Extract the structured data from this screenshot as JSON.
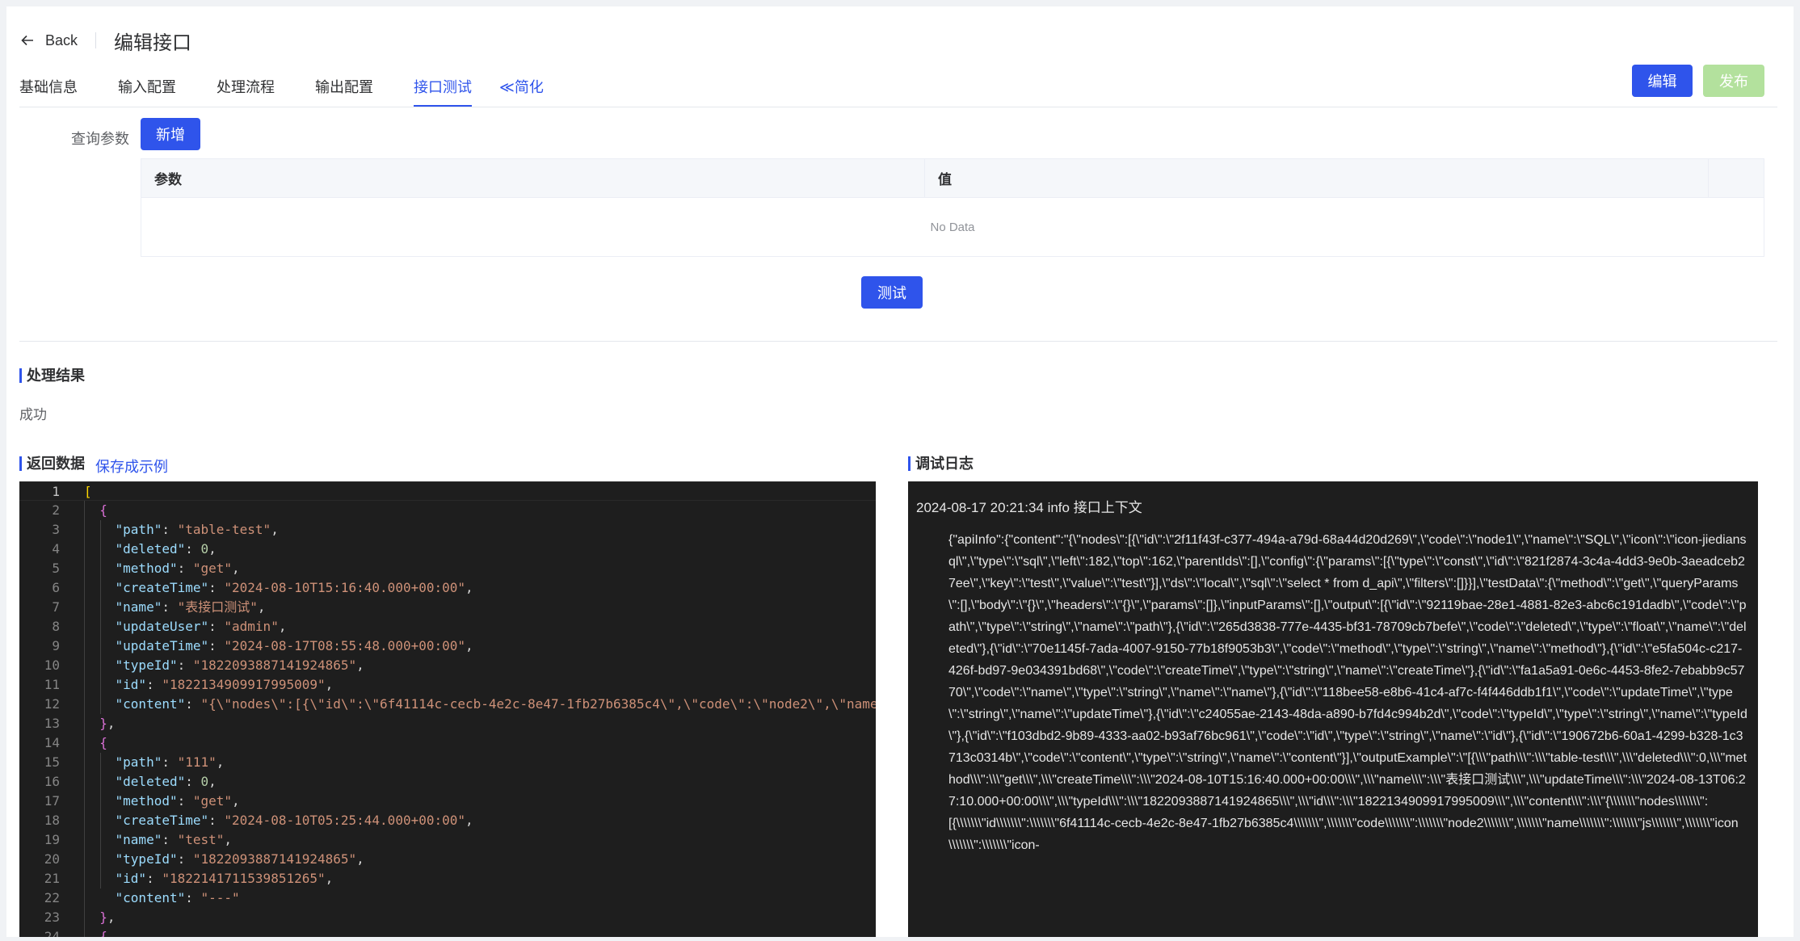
{
  "header": {
    "back_label": "Back",
    "title": "编辑接口"
  },
  "tabs": [
    {
      "label": "基础信息",
      "active": false
    },
    {
      "label": "输入配置",
      "active": false
    },
    {
      "label": "处理流程",
      "active": false
    },
    {
      "label": "输出配置",
      "active": false
    },
    {
      "label": "接口测试",
      "active": true
    }
  ],
  "collapse_label": "≪简化",
  "actions": {
    "edit_label": "编辑",
    "publish_label": "发布"
  },
  "query": {
    "label": "查询参数",
    "add_label": "新增",
    "columns": [
      "参数",
      "值"
    ],
    "empty_text": "No Data",
    "test_label": "测试"
  },
  "result": {
    "title": "处理结果",
    "value": "成功"
  },
  "returned": {
    "title": "返回数据",
    "save_label": "保存成示例"
  },
  "log": {
    "title": "调试日志",
    "header": "2024-08-17 20:21:34 info 接口上下文",
    "body": "{\"apiInfo\":{\"content\":\"{\\\"nodes\\\":[{\\\"id\\\":\\\"2f11f43f-c377-494a-a79d-68a44d20d269\\\",\\\"code\\\":\\\"node1\\\",\\\"name\\\":\\\"SQL\\\",\\\"icon\\\":\\\"icon-jiediansql\\\",\\\"type\\\":\\\"sql\\\",\\\"left\\\":182,\\\"top\\\":162,\\\"parentIds\\\":[],\\\"config\\\":{\\\"params\\\":[{\\\"type\\\":\\\"const\\\",\\\"id\\\":\\\"821f2874-3c4a-4dd3-9e0b-3aeadceb27ee\\\",\\\"key\\\":\\\"test\\\",\\\"value\\\":\\\"test\\\"}],\\\"ds\\\":\\\"local\\\",\\\"sql\\\":\\\"select * from d_api\\\",\\\"filters\\\":[]}}],\\\"testData\\\":{\\\"method\\\":\\\"get\\\",\\\"queryParams\\\":[],\\\"body\\\":\\\"{}\\\",\\\"headers\\\":\\\"{}\\\",\\\"params\\\":[]},\\\"inputParams\\\":[],\\\"output\\\":[{\\\"id\\\":\\\"92119bae-28e1-4881-82e3-abc6c191dadb\\\",\\\"code\\\":\\\"path\\\",\\\"type\\\":\\\"string\\\",\\\"name\\\":\\\"path\\\"},{\\\"id\\\":\\\"265d3838-777e-4435-bf31-78709cb7befe\\\",\\\"code\\\":\\\"deleted\\\",\\\"type\\\":\\\"float\\\",\\\"name\\\":\\\"deleted\\\"},{\\\"id\\\":\\\"70e1145f-7ada-4007-9150-77b18f9053b3\\\",\\\"code\\\":\\\"method\\\",\\\"type\\\":\\\"string\\\",\\\"name\\\":\\\"method\\\"},{\\\"id\\\":\\\"e5fa504c-c217-426f-bd97-9e034391bd68\\\",\\\"code\\\":\\\"createTime\\\",\\\"type\\\":\\\"string\\\",\\\"name\\\":\\\"createTime\\\"},{\\\"id\\\":\\\"fa1a5a91-0e6c-4453-8fe2-7ebabb9c5770\\\",\\\"code\\\":\\\"name\\\",\\\"type\\\":\\\"string\\\",\\\"name\\\":\\\"name\\\"},{\\\"id\\\":\\\"118bee58-e8b6-41c4-af7c-f4f446ddb1f1\\\",\\\"code\\\":\\\"updateTime\\\",\\\"type\\\":\\\"string\\\",\\\"name\\\":\\\"updateTime\\\"},{\\\"id\\\":\\\"c24055ae-2143-48da-a890-b7fd4c994b2d\\\",\\\"code\\\":\\\"typeId\\\",\\\"type\\\":\\\"string\\\",\\\"name\\\":\\\"typeId\\\"},{\\\"id\\\":\\\"f103dbd2-9b89-4333-aa02-b93af76bc961\\\",\\\"code\\\":\\\"id\\\",\\\"type\\\":\\\"string\\\",\\\"name\\\":\\\"id\\\"},{\\\"id\\\":\\\"190672b6-60a1-4299-b328-1c3713c0314b\\\",\\\"code\\\":\\\"content\\\",\\\"type\\\":\\\"string\\\",\\\"name\\\":\\\"content\\\"}],\\\"outputExample\\\":\\\"[{\\\\\\\"path\\\\\\\":\\\\\\\"table-test\\\\\\\",\\\\\\\"deleted\\\\\\\":0,\\\\\\\"method\\\\\\\":\\\\\\\"get\\\\\\\",\\\\\\\"createTime\\\\\\\":\\\\\\\"2024-08-10T15:16:40.000+00:00\\\\\\\",\\\\\\\"name\\\\\\\":\\\\\\\"表接口测试\\\\\\\",\\\\\\\"updateTime\\\\\\\":\\\\\\\"2024-08-13T06:27:10.000+00:00\\\\\\\",\\\\\\\"typeId\\\\\\\":\\\\\\\"1822093887141924865\\\\\\\",\\\\\\\"id\\\\\\\":\\\\\\\"1822134909917995009\\\\\\\",\\\\\\\"content\\\\\\\":\\\\\\\"{\\\\\\\\\\\\\\\"nodes\\\\\\\\\\\\\\\":[{\\\\\\\\\\\\\\\"id\\\\\\\\\\\\\\\":\\\\\\\\\\\\\\\"6f41114c-cecb-4e2c-8e47-1fb27b6385c4\\\\\\\\\\\\\\\",\\\\\\\\\\\\\\\"code\\\\\\\\\\\\\\\":\\\\\\\\\\\\\\\"node2\\\\\\\\\\\\\\\",\\\\\\\\\\\\\\\"name\\\\\\\\\\\\\\\":\\\\\\\\\\\\\\\"js\\\\\\\\\\\\\\\",\\\\\\\\\\\\\\\"icon\\\\\\\\\\\\\\\":\\\\\\\\\\\\\\\"icon-"
  },
  "editor": {
    "lines": [
      [
        [
          "b1",
          "["
        ]
      ],
      [
        [
          "p",
          "  "
        ],
        [
          "b2",
          "{"
        ]
      ],
      [
        [
          "p",
          "    "
        ],
        [
          "k",
          "\"path\""
        ],
        [
          "p",
          ": "
        ],
        [
          "s",
          "\"table-test\""
        ],
        [
          "p",
          ","
        ]
      ],
      [
        [
          "p",
          "    "
        ],
        [
          "k",
          "\"deleted\""
        ],
        [
          "p",
          ": "
        ],
        [
          "n",
          "0"
        ],
        [
          "p",
          ","
        ]
      ],
      [
        [
          "p",
          "    "
        ],
        [
          "k",
          "\"method\""
        ],
        [
          "p",
          ": "
        ],
        [
          "s",
          "\"get\""
        ],
        [
          "p",
          ","
        ]
      ],
      [
        [
          "p",
          "    "
        ],
        [
          "k",
          "\"createTime\""
        ],
        [
          "p",
          ": "
        ],
        [
          "s",
          "\"2024-08-10T15:16:40.000+00:00\""
        ],
        [
          "p",
          ","
        ]
      ],
      [
        [
          "p",
          "    "
        ],
        [
          "k",
          "\"name\""
        ],
        [
          "p",
          ": "
        ],
        [
          "s",
          "\"表接口测试\""
        ],
        [
          "p",
          ","
        ]
      ],
      [
        [
          "p",
          "    "
        ],
        [
          "k",
          "\"updateUser\""
        ],
        [
          "p",
          ": "
        ],
        [
          "s",
          "\"admin\""
        ],
        [
          "p",
          ","
        ]
      ],
      [
        [
          "p",
          "    "
        ],
        [
          "k",
          "\"updateTime\""
        ],
        [
          "p",
          ": "
        ],
        [
          "s",
          "\"2024-08-17T08:55:48.000+00:00\""
        ],
        [
          "p",
          ","
        ]
      ],
      [
        [
          "p",
          "    "
        ],
        [
          "k",
          "\"typeId\""
        ],
        [
          "p",
          ": "
        ],
        [
          "s",
          "\"1822093887141924865\""
        ],
        [
          "p",
          ","
        ]
      ],
      [
        [
          "p",
          "    "
        ],
        [
          "k",
          "\"id\""
        ],
        [
          "p",
          ": "
        ],
        [
          "s",
          "\"1822134909917995009\""
        ],
        [
          "p",
          ","
        ]
      ],
      [
        [
          "p",
          "    "
        ],
        [
          "k",
          "\"content\""
        ],
        [
          "p",
          ": "
        ],
        [
          "s",
          "\"{\\\"nodes\\\":[{\\\"id\\\":\\\"6f41114c-cecb-4e2c-8e47-1fb27b6385c4\\\",\\\"code\\\":\\\"node2\\\",\\\"name"
        ]
      ],
      [
        [
          "p",
          "  "
        ],
        [
          "b2",
          "}"
        ],
        [
          "p",
          ","
        ]
      ],
      [
        [
          "p",
          "  "
        ],
        [
          "b2",
          "{"
        ]
      ],
      [
        [
          "p",
          "    "
        ],
        [
          "k",
          "\"path\""
        ],
        [
          "p",
          ": "
        ],
        [
          "s",
          "\"111\""
        ],
        [
          "p",
          ","
        ]
      ],
      [
        [
          "p",
          "    "
        ],
        [
          "k",
          "\"deleted\""
        ],
        [
          "p",
          ": "
        ],
        [
          "n",
          "0"
        ],
        [
          "p",
          ","
        ]
      ],
      [
        [
          "p",
          "    "
        ],
        [
          "k",
          "\"method\""
        ],
        [
          "p",
          ": "
        ],
        [
          "s",
          "\"get\""
        ],
        [
          "p",
          ","
        ]
      ],
      [
        [
          "p",
          "    "
        ],
        [
          "k",
          "\"createTime\""
        ],
        [
          "p",
          ": "
        ],
        [
          "s",
          "\"2024-08-10T05:25:44.000+00:00\""
        ],
        [
          "p",
          ","
        ]
      ],
      [
        [
          "p",
          "    "
        ],
        [
          "k",
          "\"name\""
        ],
        [
          "p",
          ": "
        ],
        [
          "s",
          "\"test\""
        ],
        [
          "p",
          ","
        ]
      ],
      [
        [
          "p",
          "    "
        ],
        [
          "k",
          "\"typeId\""
        ],
        [
          "p",
          ": "
        ],
        [
          "s",
          "\"1822093887141924865\""
        ],
        [
          "p",
          ","
        ]
      ],
      [
        [
          "p",
          "    "
        ],
        [
          "k",
          "\"id\""
        ],
        [
          "p",
          ": "
        ],
        [
          "s",
          "\"1822141711539851265\""
        ],
        [
          "p",
          ","
        ]
      ],
      [
        [
          "p",
          "    "
        ],
        [
          "k",
          "\"content\""
        ],
        [
          "p",
          ": "
        ],
        [
          "s",
          "\"---\""
        ]
      ],
      [
        [
          "p",
          "  "
        ],
        [
          "b2",
          "}"
        ],
        [
          "p",
          ","
        ]
      ],
      [
        [
          "p",
          "  "
        ],
        [
          "b2",
          "{"
        ]
      ]
    ]
  }
}
